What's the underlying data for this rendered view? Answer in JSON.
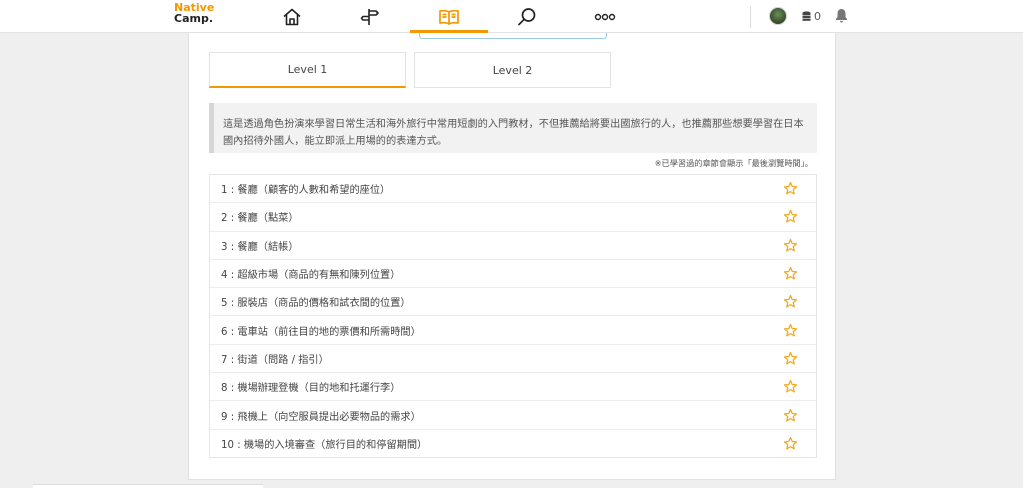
{
  "logo": {
    "line1": "Native",
    "line2": "Camp."
  },
  "nav": {
    "items": [
      {
        "name": "home-icon"
      },
      {
        "name": "signpost-icon"
      },
      {
        "name": "book-icon",
        "active": true
      },
      {
        "name": "search-icon"
      },
      {
        "name": "more-icon"
      }
    ],
    "accent": "#f39800"
  },
  "user": {
    "coins": "0"
  },
  "tabs": [
    {
      "label": "Level 1",
      "active": true
    },
    {
      "label": "Level 2",
      "active": false
    }
  ],
  "description": "這是透過角色扮演來學習日常生活和海外旅行中常用短劇的入門教材，不但推薦給將要出國旅行的人，也推薦那些想要學習在日本國內招待外國人，能立即派上用場的的表達方式。",
  "note": "※已學習過的章節會顯示「最後瀏覽時間」。",
  "chapters": [
    {
      "label": "1 : 餐廳（顧客的人數和希望的座位）"
    },
    {
      "label": "2 : 餐廳（點菜）"
    },
    {
      "label": "3 : 餐廳（結帳）"
    },
    {
      "label": "4 : 超級市場（商品的有無和陳列位置）"
    },
    {
      "label": "5 : 服裝店（商品的價格和試衣間的位置）"
    },
    {
      "label": "6 : 電車站（前往目的地的票價和所需時間）"
    },
    {
      "label": "7 : 街道（問路 / 指引）"
    },
    {
      "label": "8 : 機場辦理登機（目的地和托運行李）"
    },
    {
      "label": "9 : 飛機上（向空服員提出必要物品的需求）"
    },
    {
      "label": "10 : 機場的入境審查（旅行目的和停留期間）"
    }
  ],
  "colors": {
    "star": "#f3a71c",
    "tab_active": "#f39800"
  }
}
